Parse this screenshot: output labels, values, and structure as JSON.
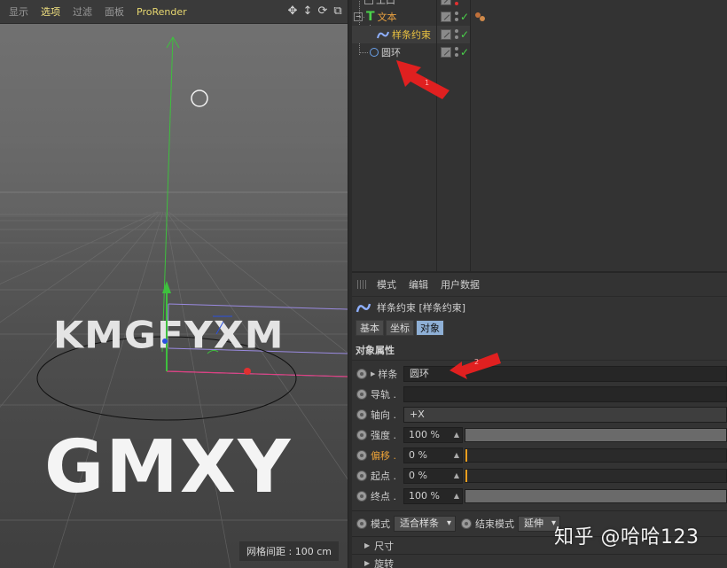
{
  "viewport": {
    "menu": [
      "显示",
      "选项",
      "过滤",
      "面板",
      "ProRender"
    ],
    "active_menu_index": 1,
    "nav_icons": [
      "move-icon",
      "zoom-icon",
      "rotate-icon",
      "maximize-icon"
    ],
    "ring_text_back": "KMGFYXM",
    "ring_text_front": "GMXY",
    "grid_readout": "网格间距 : 100 cm"
  },
  "object_manager": {
    "objects": [
      {
        "name": "工口",
        "icon": "null-object-icon"
      },
      {
        "name": "文本",
        "icon": "text-spline-icon",
        "color": "#e8a040"
      },
      {
        "name": "样条约束",
        "icon": "spline-wrap-icon",
        "color": "#e8c040",
        "selected": true
      },
      {
        "name": "圆环",
        "icon": "circle-spline-icon",
        "color": "#cfcfcf"
      }
    ],
    "annotation_1": "1"
  },
  "attribute_manager": {
    "menu": [
      "模式",
      "编辑",
      "用户数据"
    ],
    "object_title": "样条约束 [样条约束]",
    "tabs": [
      "基本",
      "坐标",
      "对象"
    ],
    "active_tab": 2,
    "section": "对象属性",
    "params": {
      "spline": {
        "label": "样条",
        "value": "圆环"
      },
      "rail": {
        "label": "导轨 ."
      },
      "axis": {
        "label": "轴向 .",
        "value": "+X"
      },
      "strength": {
        "label": "强度 .",
        "value": "100 %",
        "fill": 1.0
      },
      "offset": {
        "label": "偏移 .",
        "value": "0 %",
        "fill": 0.0
      },
      "start": {
        "label": "起点 .",
        "value": "0 %",
        "fill": 0.0
      },
      "end": {
        "label": "终点 .",
        "value": "100 %",
        "fill": 1.0
      }
    },
    "mode_label": "模式",
    "mode_value": "适合样条",
    "end_mode_label": "结束模式",
    "end_mode_value": "延伸",
    "fold_size": "尺寸",
    "fold_rotate": "旋转",
    "annotation_2": "2"
  },
  "watermark": "知乎 @哈哈123",
  "colors": {
    "accent_blue": "#8fb0d6",
    "arrow_red": "#e02020",
    "offset_orange": "#e8a038"
  }
}
